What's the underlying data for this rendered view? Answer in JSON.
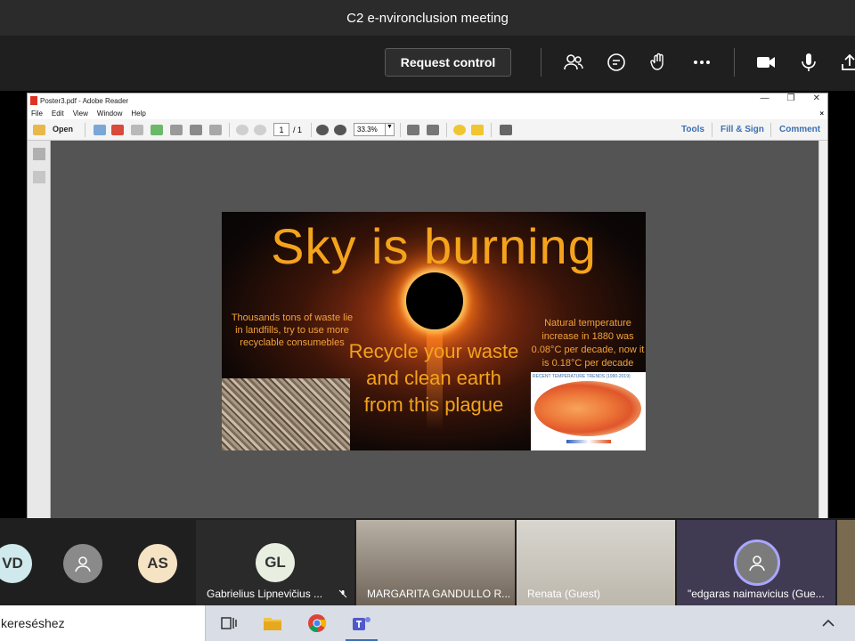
{
  "meeting": {
    "title": "C2 e-nvironclusion meeting"
  },
  "toolbar": {
    "request_control_label": "Request control",
    "icons": [
      "people-icon",
      "chat-icon",
      "raise-hand-icon",
      "more-icon",
      "camera-icon",
      "mic-icon",
      "share-icon"
    ]
  },
  "reader": {
    "window_title": "Poster3.pdf - Adobe Reader",
    "menu": [
      "File",
      "Edit",
      "View",
      "Window",
      "Help"
    ],
    "open_label": "Open",
    "page_current": "1",
    "page_total": "/ 1",
    "zoom": "33.3%",
    "links": {
      "tools": "Tools",
      "fill_sign": "Fill & Sign",
      "comment": "Comment"
    }
  },
  "poster": {
    "title": "Sky is burning",
    "left_text": "Thousands tons of waste lie in landfills, try to use more recyclable consumebles",
    "center_text": "Recycle your waste and clean earth from this plague",
    "right_text": "Natural temperature increase in 1880 was 0.08°C per decade, now it is 0.18°C per decade",
    "map_caption": "RECENT TEMPERATURE TRENDS (1990-2019)"
  },
  "participants": [
    {
      "initials": "VD",
      "color": "#cfe9ec"
    },
    {
      "initials": "",
      "color": "#8a8a8a"
    },
    {
      "initials": "AS",
      "color": "#f6e3c4"
    },
    {
      "initials": "GL",
      "color": "#e8eee0",
      "name": "Gabrielius Lipnevičius ..."
    },
    {
      "name": "MARGARITA GANDULLO R..."
    },
    {
      "name": "Renata (Guest)"
    },
    {
      "name": "\"edgaras naimavicius (Gue..."
    }
  ],
  "taskbar": {
    "search_text": "kereséshez"
  },
  "colors": {
    "accent": "#f4a31c",
    "teams_dark": "#1f1f1f",
    "reader_link": "#3b6fb3"
  }
}
